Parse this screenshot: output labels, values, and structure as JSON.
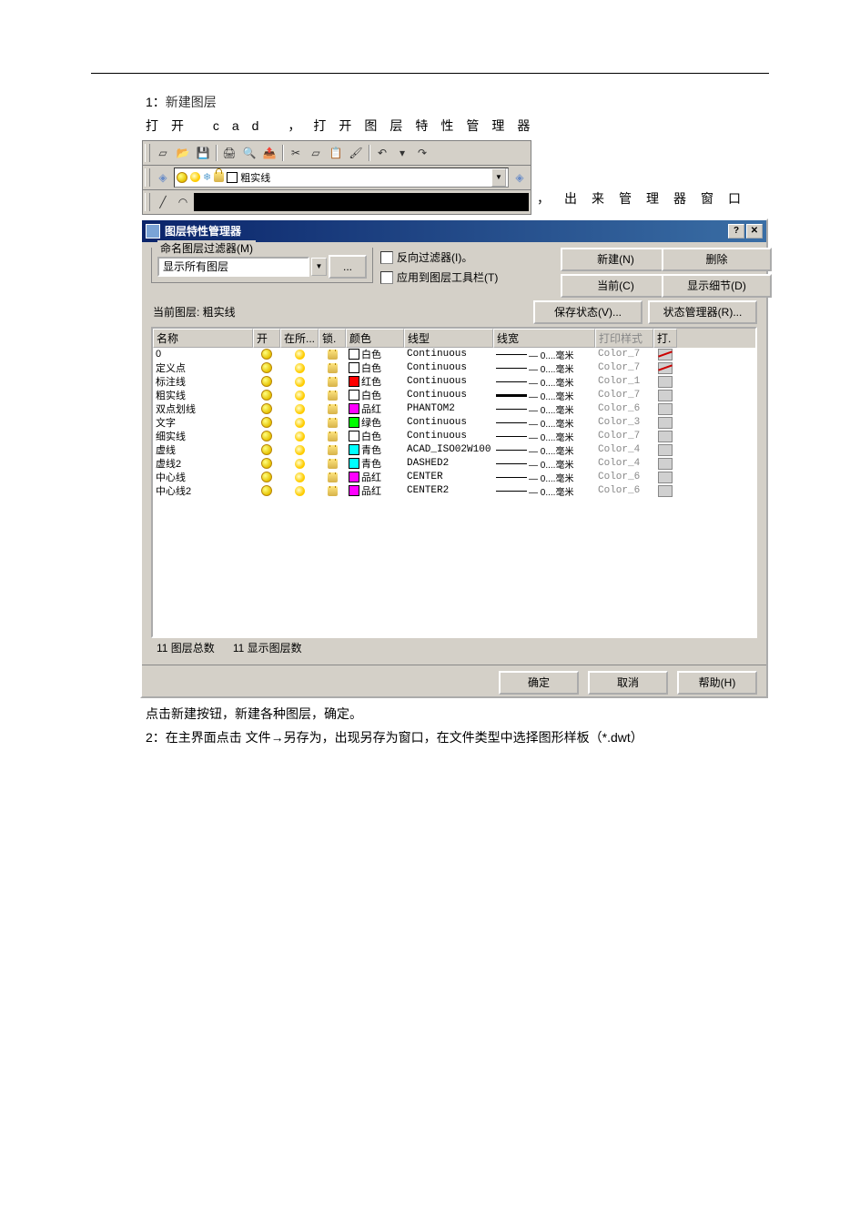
{
  "doc": {
    "line1_prefix": "1：",
    "line1_title": "新建图层",
    "line2_text": "打开 cad ，打开图层特性管理器",
    "line2_right": "，出来管理器窗口",
    "layer_in_combo": "粗实线",
    "after1": "点击新建按钮，新建各种图层，确定。",
    "after2": "2：在主界面点击 文件→另存为，出现另存为窗口，在文件类型中选择图形样板（*.dwt）"
  },
  "dialog": {
    "title": "图层特性管理器",
    "help_sym": "?",
    "close_sym": "✕",
    "filter_legend": "命名图层过滤器(M)",
    "filter_selected": "显示所有图层",
    "dots": "...",
    "chk_invert": "反向过滤器(I)。",
    "chk_apply": "应用到图层工具栏(T)",
    "btn_new": "新建(N)",
    "btn_delete": "删除",
    "btn_current": "当前(C)",
    "btn_details": "显示细节(D)",
    "btn_savestate": "保存状态(V)...",
    "btn_statemgr": "状态管理器(R)...",
    "current_label": "当前图层:  粗实线",
    "btn_ok": "确定",
    "btn_cancel": "取消",
    "btn_help": "帮助(H)",
    "footer_total_label": "11 图层总数",
    "footer_shown_label": "11 显示图层数",
    "headers": {
      "name": "名称",
      "on": "开",
      "all": "在所...",
      "lock": "锁.",
      "color": "颜色",
      "ltype": "线型",
      "lw": "线宽",
      "pstyle": "打印样式",
      "plot": "打."
    },
    "layers": [
      {
        "name": "0",
        "color_hex": "#ffffff",
        "color_name": "白色",
        "ltype": "Continuous",
        "lw_thick": false,
        "lw_text": "— 0....毫米",
        "pstyle": "Color_7",
        "plot": false
      },
      {
        "name": "定义点",
        "color_hex": "#ffffff",
        "color_name": "白色",
        "ltype": "Continuous",
        "lw_thick": false,
        "lw_text": "— 0....毫米",
        "pstyle": "Color_7",
        "plot": false
      },
      {
        "name": "标注线",
        "color_hex": "#ff0000",
        "color_name": "红色",
        "ltype": "Continuous",
        "lw_thick": false,
        "lw_text": "— 0....毫米",
        "pstyle": "Color_1",
        "plot": true
      },
      {
        "name": "粗实线",
        "color_hex": "#ffffff",
        "color_name": "白色",
        "ltype": "Continuous",
        "lw_thick": true,
        "lw_text": "— 0....毫米",
        "pstyle": "Color_7",
        "plot": true
      },
      {
        "name": "双点划线",
        "color_hex": "#ff00ff",
        "color_name": "品红",
        "ltype": "PHANTOM2",
        "lw_thick": false,
        "lw_text": "— 0....毫米",
        "pstyle": "Color_6",
        "plot": true
      },
      {
        "name": "文字",
        "color_hex": "#00ff00",
        "color_name": "绿色",
        "ltype": "Continuous",
        "lw_thick": false,
        "lw_text": "— 0....毫米",
        "pstyle": "Color_3",
        "plot": true
      },
      {
        "name": "细实线",
        "color_hex": "#ffffff",
        "color_name": "白色",
        "ltype": "Continuous",
        "lw_thick": false,
        "lw_text": "— 0....毫米",
        "pstyle": "Color_7",
        "plot": true
      },
      {
        "name": "虚线",
        "color_hex": "#00ffff",
        "color_name": "青色",
        "ltype": "ACAD_ISO02W100",
        "lw_thick": false,
        "lw_text": "— 0....毫米",
        "pstyle": "Color_4",
        "plot": true
      },
      {
        "name": "虚线2",
        "color_hex": "#00ffff",
        "color_name": "青色",
        "ltype": "DASHED2",
        "lw_thick": false,
        "lw_text": "— 0....毫米",
        "pstyle": "Color_4",
        "plot": true
      },
      {
        "name": "中心线",
        "color_hex": "#ff00ff",
        "color_name": "品红",
        "ltype": "CENTER",
        "lw_thick": false,
        "lw_text": "— 0....毫米",
        "pstyle": "Color_6",
        "plot": true
      },
      {
        "name": "中心线2",
        "color_hex": "#ff00ff",
        "color_name": "品红",
        "ltype": "CENTER2",
        "lw_thick": false,
        "lw_text": "— 0....毫米",
        "pstyle": "Color_6",
        "plot": true
      }
    ]
  }
}
